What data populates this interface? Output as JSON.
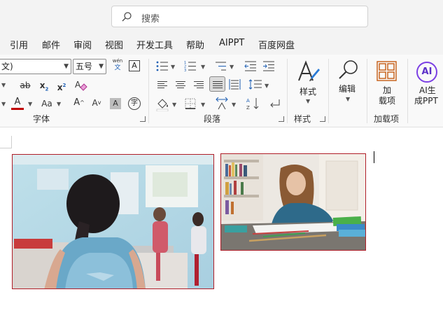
{
  "search": {
    "placeholder": "搜索",
    "icon": "search-icon"
  },
  "menu": {
    "tabs": [
      "引用",
      "邮件",
      "审阅",
      "视图",
      "开发工具",
      "帮助",
      "AIPPT",
      "百度网盘"
    ]
  },
  "font_group": {
    "font_name": "文)",
    "font_size": "五号",
    "phonetic_top": "wén",
    "phonetic_bottom": "文",
    "border_char": "A",
    "strike": "ab",
    "subscript": "x",
    "subscript_mark": "2",
    "superscript": "x",
    "superscript_mark": "2",
    "font_color": "A",
    "case": "Aa",
    "grow": "A",
    "shrink": "A",
    "shade_char": "A",
    "enclose_char": "字",
    "label": "字体"
  },
  "paragraph_group": {
    "label": "段落"
  },
  "styles_group": {
    "button_label": "样式",
    "label": "样式"
  },
  "editing_group": {
    "button_label": "编辑"
  },
  "addins_group": {
    "button_line1": "加",
    "button_line2": "载项",
    "label": "加载项"
  },
  "ai_group": {
    "icon_text": "AI",
    "button_line1": "AI生",
    "button_line2": "成PPT"
  },
  "colors": {
    "accent": "#c00000",
    "image_border": "#b01e28",
    "ai_purple": "#7b3fe4"
  }
}
